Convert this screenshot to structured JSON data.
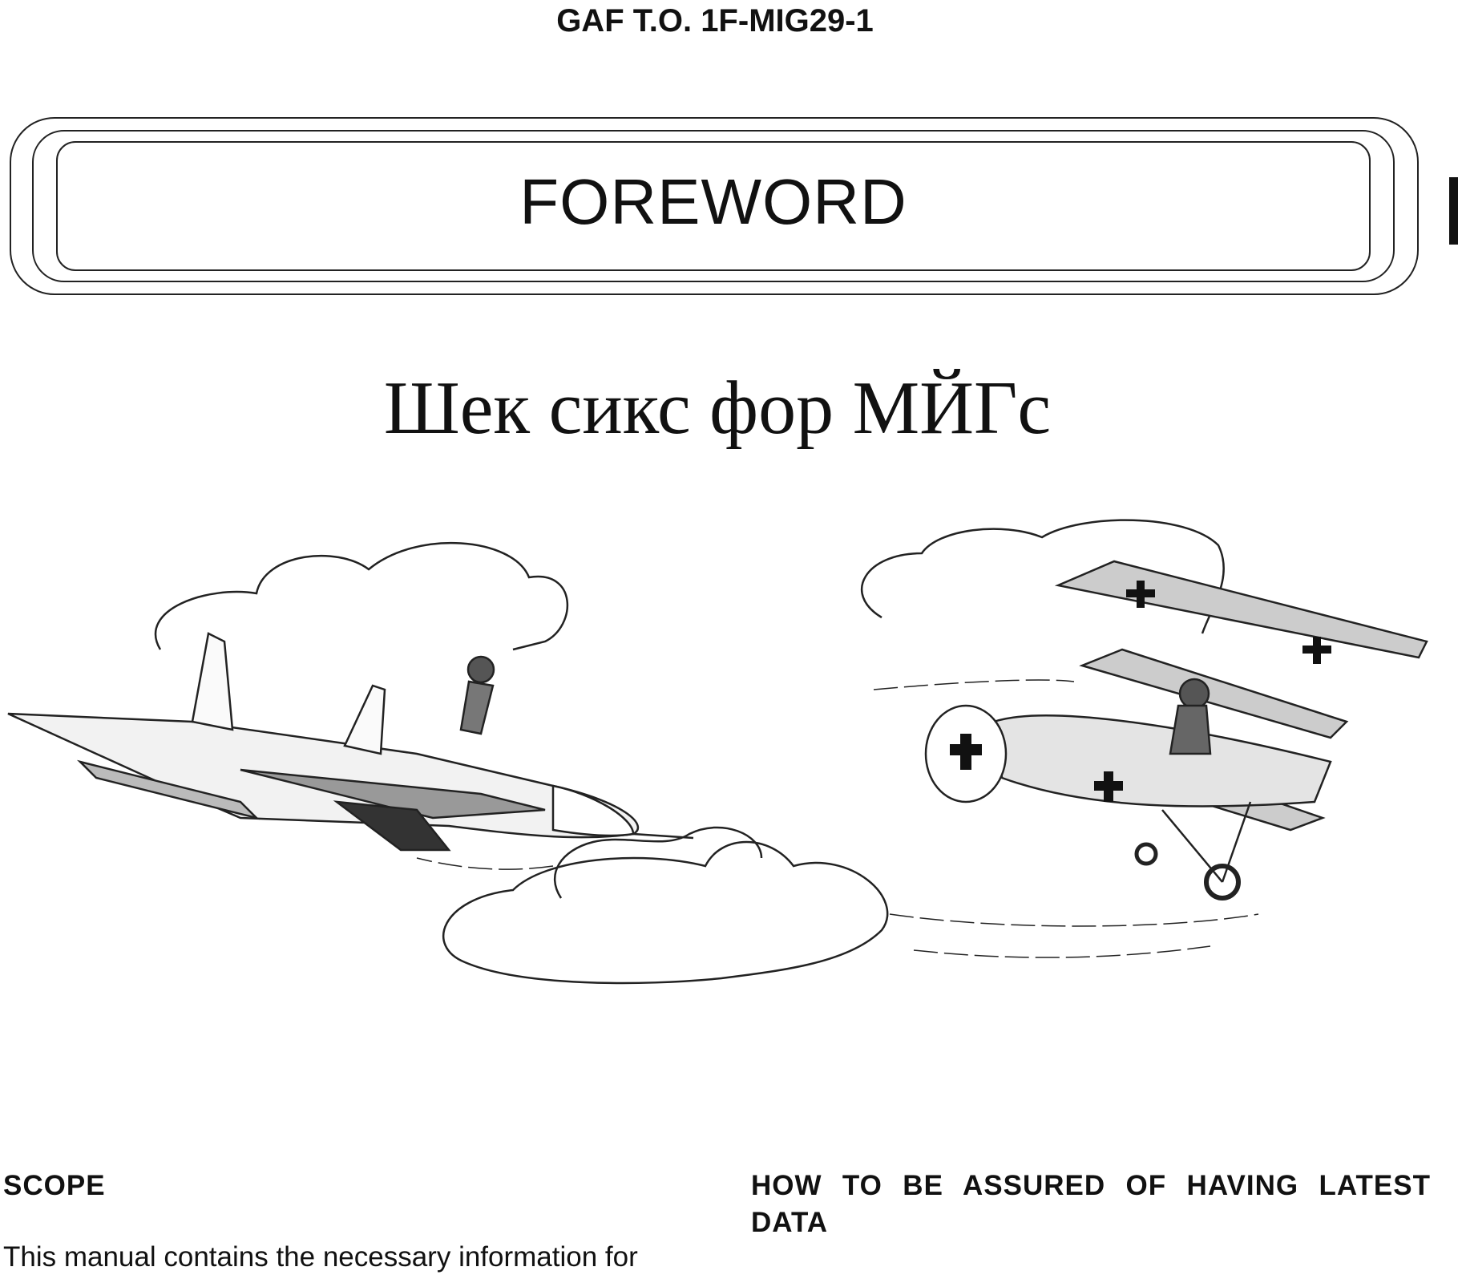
{
  "header": {
    "doc_id": "GAF T.O. 1F-MIG29-1"
  },
  "banner": {
    "title": "FOREWORD"
  },
  "subtitle": "Шек сикс фор МЙГс",
  "sections": [
    {
      "heading": "SCOPE",
      "body": "This manual contains the necessary information for"
    },
    {
      "heading": "HOW TO BE ASSURED OF HAVING LATEST DATA"
    }
  ]
}
